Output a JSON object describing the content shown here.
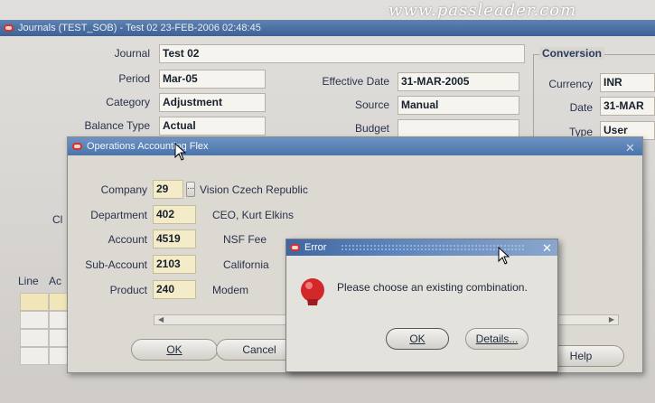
{
  "app": {
    "title": "Journals (TEST_SOB) - Test 02 23-FEB-2006 02:48:45",
    "watermark": "www.passleader.com",
    "accent_color": "#3d6196"
  },
  "journal": {
    "journal_label": "Journal",
    "journal_value": "Test 02",
    "period_label": "Period",
    "period_value": "Mar-05",
    "category_label": "Category",
    "category_value": "Adjustment",
    "balance_type_label": "Balance Type",
    "balance_type_value": "Actual",
    "effective_date_label": "Effective Date",
    "effective_date_value": "31-MAR-2005",
    "source_label": "Source",
    "source_value": "Manual",
    "budget_label": "Budget",
    "budget_value": ""
  },
  "conversion": {
    "title": "Conversion",
    "currency_label": "Currency",
    "currency_value": "INR",
    "date_label": "Date",
    "date_value": "31-MAR",
    "type_label": "Type",
    "type_value": "User"
  },
  "lines_grid": {
    "cl_label": "Cl",
    "col_line": "Line",
    "col_ac": "Ac"
  },
  "flex_dialog": {
    "title": "Operations Accounting Flex",
    "segments": [
      {
        "label": "Company",
        "value": "29",
        "description": "Vision Czech Republic"
      },
      {
        "label": "Department",
        "value": "402",
        "description": "CEO, Kurt Elkins"
      },
      {
        "label": "Account",
        "value": "4519",
        "description": "NSF Fee"
      },
      {
        "label": "Sub-Account",
        "value": "2103",
        "description": "California"
      },
      {
        "label": "Product",
        "value": "240",
        "description": "Modem"
      }
    ],
    "ok_label": "OK",
    "cancel_label": "Cancel",
    "help_label": "Help",
    "lov_indicator": "..."
  },
  "error_dialog": {
    "title": "Error",
    "message": "Please choose an existing combination.",
    "ok_label": "OK",
    "details_label": "Details..."
  }
}
